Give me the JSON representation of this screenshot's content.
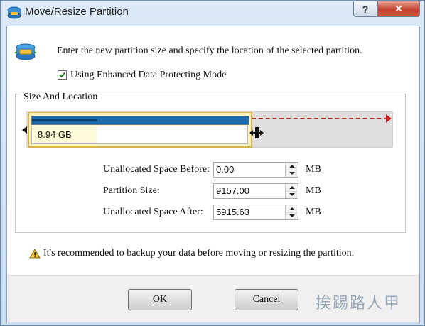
{
  "window": {
    "title": "Move/Resize Partition",
    "help_glyph": "?",
    "close_glyph": "✕"
  },
  "header": {
    "instruction": "Enter the new partition size and specify the location of the selected partition.",
    "checkbox_label": "Using Enhanced Data Protecting Mode",
    "checkbox_checked": true
  },
  "size_location": {
    "group_title": "Size And Location",
    "partition_size_label": "8.94 GB",
    "used_fraction": 0.3
  },
  "fields": [
    {
      "label": "Unallocated Space Before:",
      "value": "0.00",
      "unit": "MB"
    },
    {
      "label": "Partition Size:",
      "value": "9157.00",
      "unit": "MB"
    },
    {
      "label": "Unallocated Space After:",
      "value": "5915.63",
      "unit": "MB"
    }
  ],
  "warning": "It's recommended to backup your data before moving or resizing the partition.",
  "buttons": {
    "ok": "OK",
    "cancel": "Cancel"
  },
  "watermark": "挨踢路人甲",
  "colors": {
    "used_bar": "#1e6aa8",
    "arrow": "#cc2020",
    "partition_border": "#d8b24a"
  }
}
